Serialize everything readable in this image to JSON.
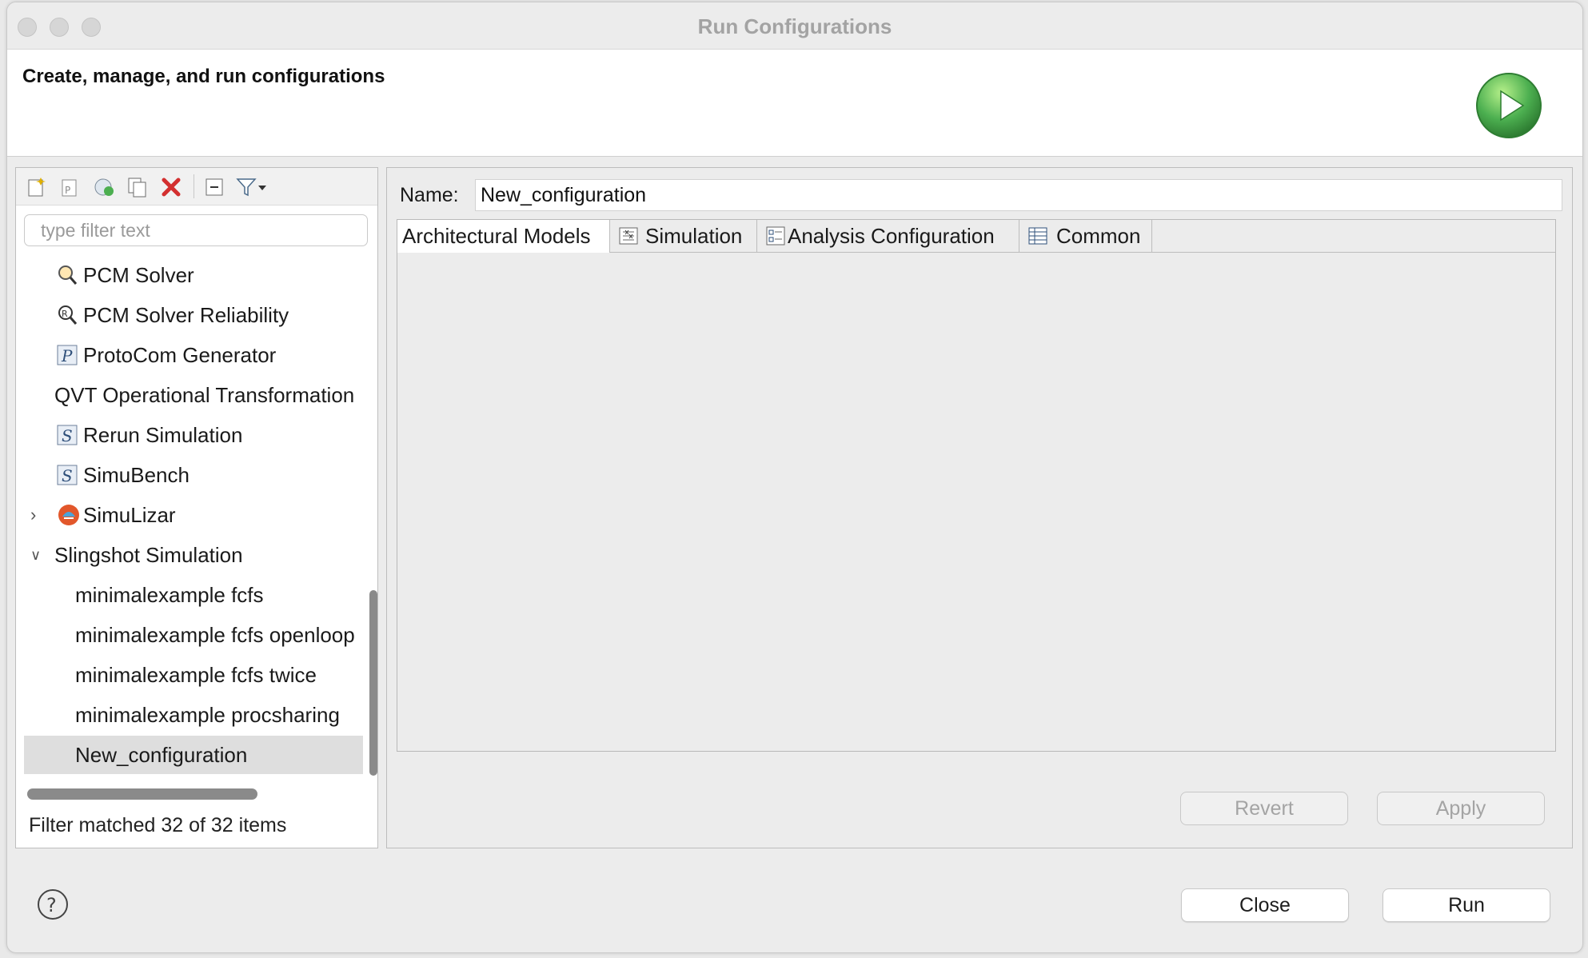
{
  "window": {
    "title": "Run Configurations"
  },
  "header": {
    "text": "Create, manage, and run configurations",
    "icon": "run-play-icon"
  },
  "toolbar": {
    "icons": [
      "new-configuration-icon",
      "new-prototype-icon",
      "export-icon",
      "duplicate-icon",
      "delete-icon",
      "collapse-all-icon",
      "filter-icon",
      "dropdown-icon"
    ]
  },
  "filter": {
    "placeholder": "type filter text"
  },
  "tree": {
    "items": [
      {
        "label": "PCM Solver",
        "icon": "pcm-solver-icon",
        "level": 1
      },
      {
        "label": "PCM Solver Reliability",
        "icon": "pcm-solver-reliability-icon",
        "level": 1
      },
      {
        "label": "ProtoCom Generator",
        "icon": "protocom-icon",
        "level": 1
      },
      {
        "label": "QVT Operational Transformation",
        "icon": "",
        "level": 1
      },
      {
        "label": "Rerun Simulation",
        "icon": "simulation-s-icon",
        "level": 1
      },
      {
        "label": "SimuBench",
        "icon": "simulation-s-icon",
        "level": 1
      },
      {
        "label": "SimuLizar",
        "icon": "simulizar-icon",
        "level": 1,
        "expanded": false
      },
      {
        "label": "Slingshot Simulation",
        "icon": "",
        "level": 1,
        "expanded": true
      },
      {
        "label": "minimalexample fcfs",
        "level": 2
      },
      {
        "label": "minimalexample fcfs openloop",
        "level": 2
      },
      {
        "label": "minimalexample fcfs twice",
        "level": 2
      },
      {
        "label": "minimalexample procsharing",
        "level": 2
      },
      {
        "label": "New_configuration",
        "level": 2,
        "selected": true
      }
    ]
  },
  "status": {
    "filter_text": "Filter matched 32 of 32 items"
  },
  "config": {
    "name_label": "Name:",
    "name_value": "New_configuration",
    "tabs": [
      {
        "label": "Architectural Models",
        "icon": "",
        "active": true
      },
      {
        "label": "Simulation",
        "icon": "simulation-tab-icon"
      },
      {
        "label": "Analysis Configuration",
        "icon": "analysis-tab-icon"
      },
      {
        "label": "Common",
        "icon": "common-tab-icon"
      }
    ]
  },
  "buttons": {
    "revert": "Revert",
    "apply": "Apply",
    "close": "Close",
    "run": "Run"
  },
  "colors": {
    "accent_green": "#4caf50",
    "delete_red": "#d32f2f"
  }
}
